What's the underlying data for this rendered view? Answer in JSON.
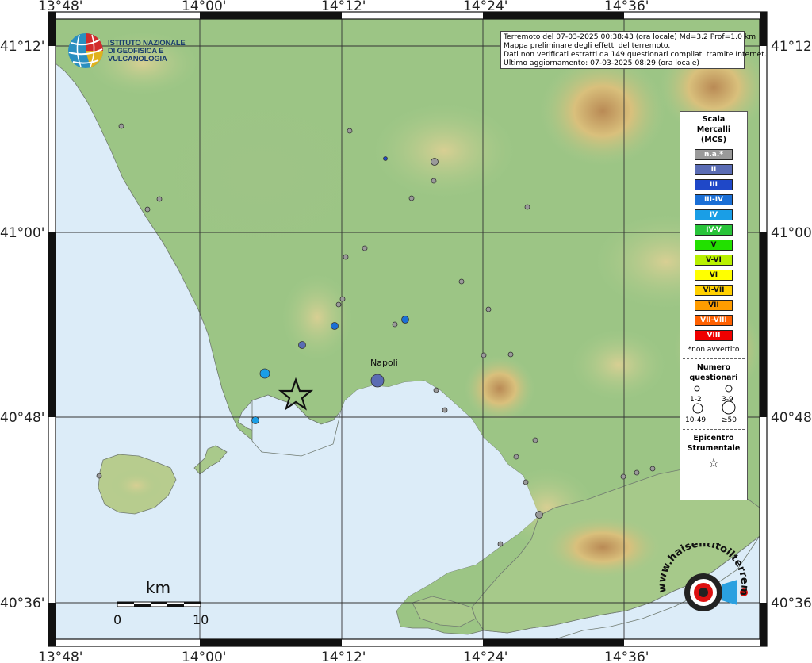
{
  "info_box": {
    "line1": "Terremoto del 07-03-2025 00:38:43 (ora locale) Md=3.2 Prof=1.0 km",
    "line2": "Mappa preliminare degli effetti del terremoto.",
    "line3": "Dati non verificati estratti da 149 questionari compilati tramite Internet.",
    "line4": "Ultimo aggiornamento: 07-03-2025 08:29 (ora locale)"
  },
  "logo": {
    "line1": "ISTITUTO NAZIONALE",
    "line2": "DI GEOFISICA E VULCANOLOGIA"
  },
  "axes": {
    "lon_labels": [
      "13°48'",
      "14°00'",
      "14°12'",
      "14°24'",
      "14°36'"
    ],
    "lat_labels": [
      "41°12'",
      "41°00'",
      "40°48'",
      "40°36'"
    ]
  },
  "legend": {
    "title1": "Scala",
    "title2": "Mercalli",
    "title3": "(MCS)",
    "classes": [
      {
        "label": "n.a.*",
        "color": "#9a9a9a"
      },
      {
        "label": "II",
        "color": "#5a6cb4"
      },
      {
        "label": "III",
        "color": "#1f48c8"
      },
      {
        "label": "III-IV",
        "color": "#1a6fd6"
      },
      {
        "label": "IV",
        "color": "#1a9ee6"
      },
      {
        "label": "IV-V",
        "color": "#29c43a"
      },
      {
        "label": "V",
        "color": "#22e000"
      },
      {
        "label": "V-VI",
        "color": "#b8f000"
      },
      {
        "label": "VI",
        "color": "#ffff00"
      },
      {
        "label": "VI-VII",
        "color": "#ffd000"
      },
      {
        "label": "VII",
        "color": "#ff9c00"
      },
      {
        "label": "VII-VIII",
        "color": "#ff6000"
      },
      {
        "label": "VIII",
        "color": "#f00000"
      }
    ],
    "note": "*non avvertito",
    "numero_title1": "Numero",
    "numero_title2": "questionari",
    "size_labels": [
      "1-2",
      "3-9",
      "10-49",
      "≥50"
    ],
    "epicentro1": "Epicentro",
    "epicentro2": "Strumentale"
  },
  "city_label": "Napoli",
  "scale_bar": {
    "unit": "km",
    "min": "0",
    "max": "10"
  },
  "watermark": {
    "text": "www.haisentitoilterremoto.it"
  }
}
